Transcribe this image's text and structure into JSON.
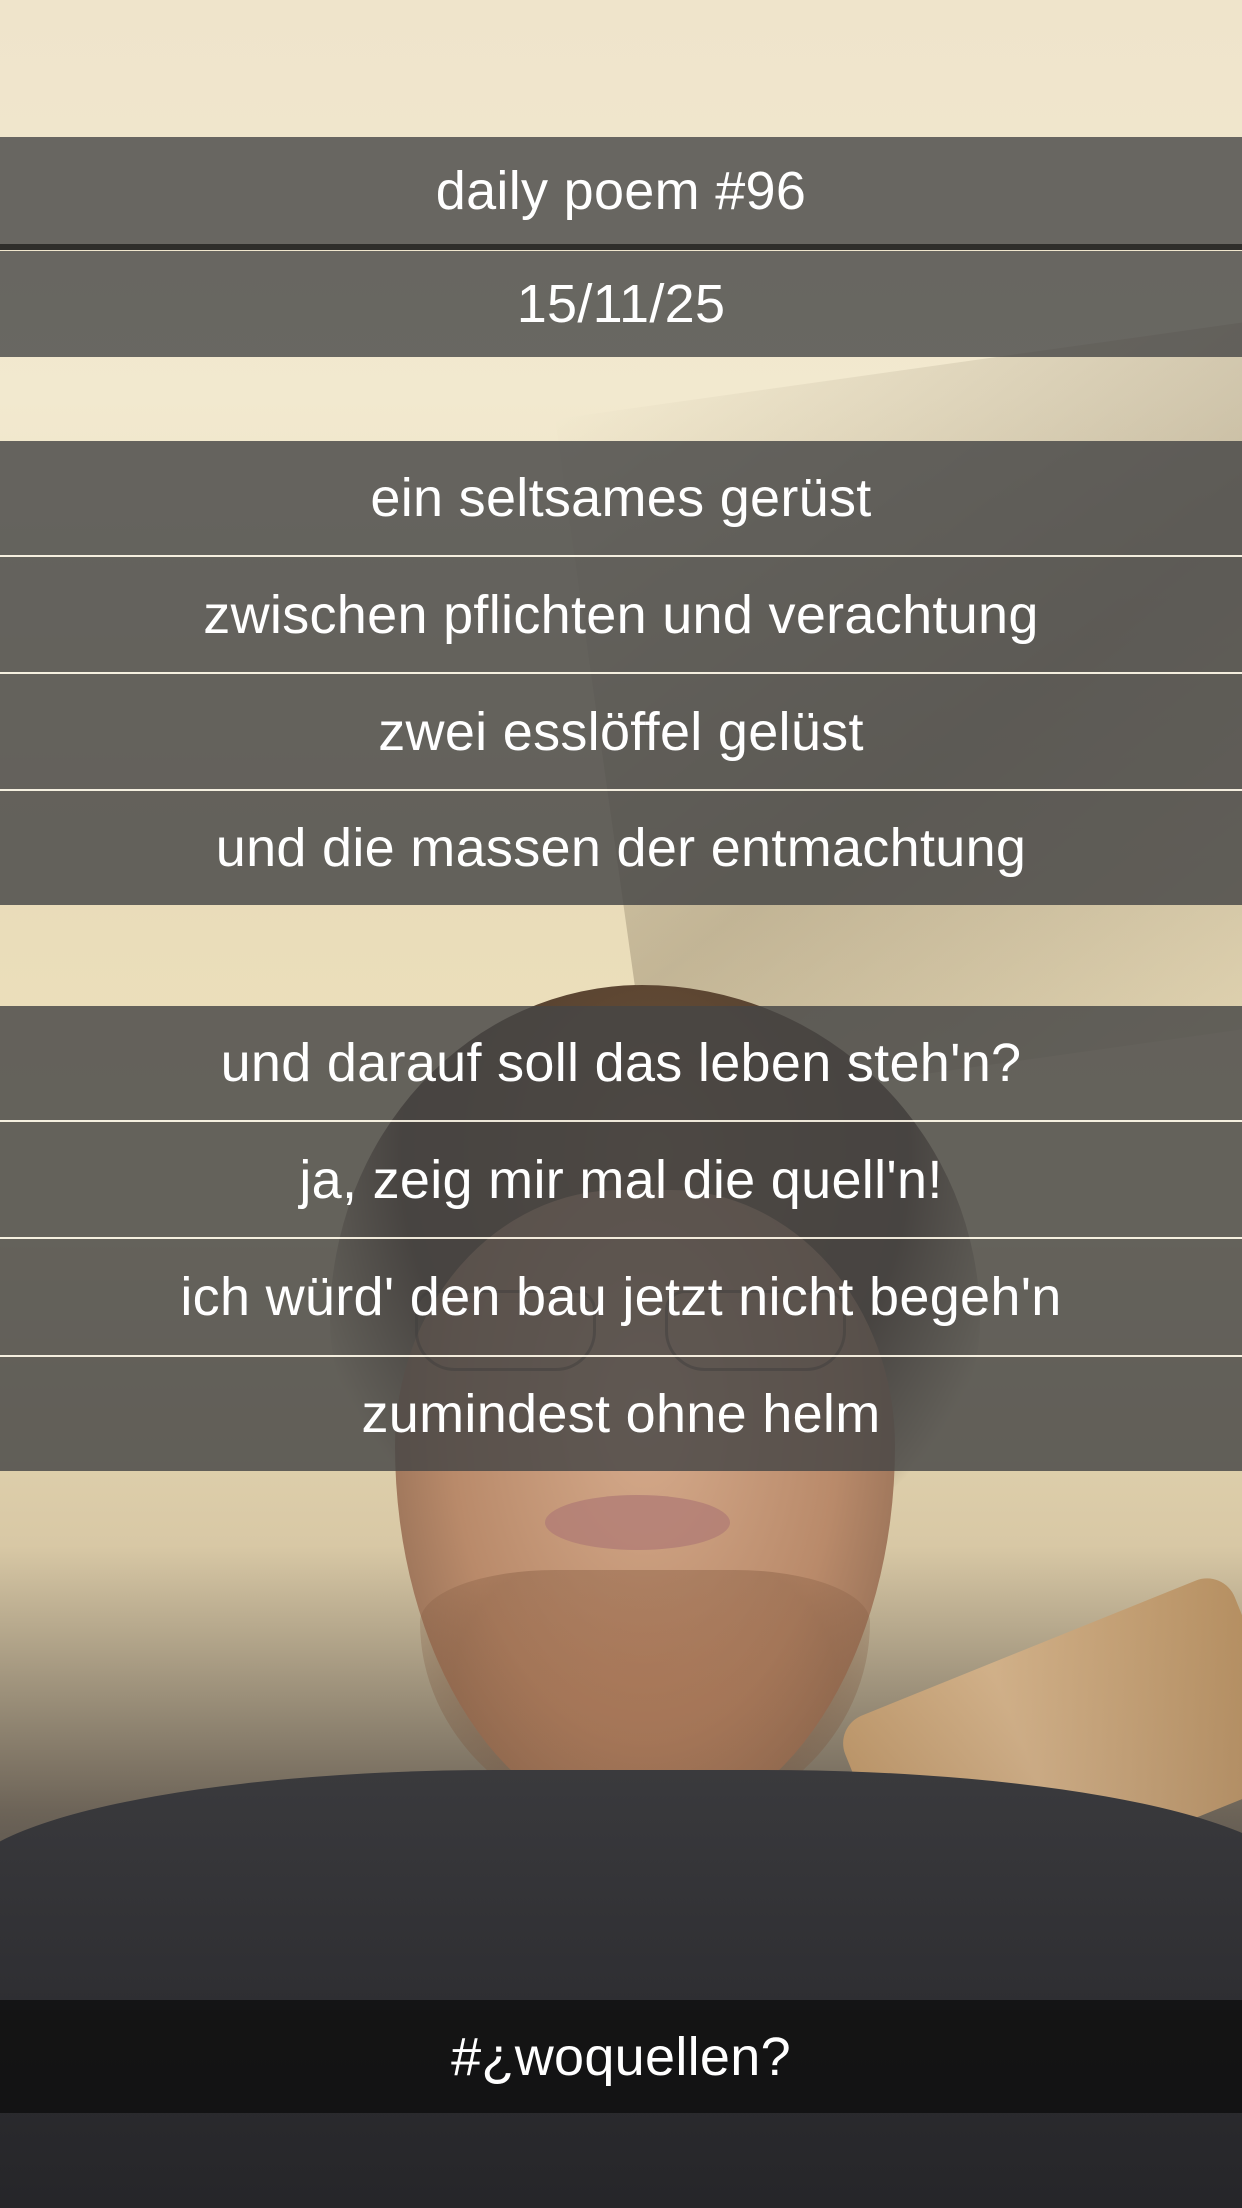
{
  "header": {
    "title": "daily poem #96",
    "date": "15/11/25"
  },
  "stanza1": {
    "lines": [
      "ein seltsames gerüst",
      "zwischen pflichten und verachtung",
      "zwei esslöffel gelüst",
      "und die massen der entmachtung"
    ]
  },
  "stanza2": {
    "lines": [
      "und darauf soll das leben steh'n?",
      "ja, zeig mir mal die quell'n!",
      "ich würd' den bau jetzt nicht begeh'n",
      "zumindest ohne helm"
    ]
  },
  "footer": {
    "hashtag": "#¿woquellen?"
  },
  "colors": {
    "bar": "#464646",
    "tag_bar": "#0f0f0f",
    "text": "#ffffff"
  }
}
